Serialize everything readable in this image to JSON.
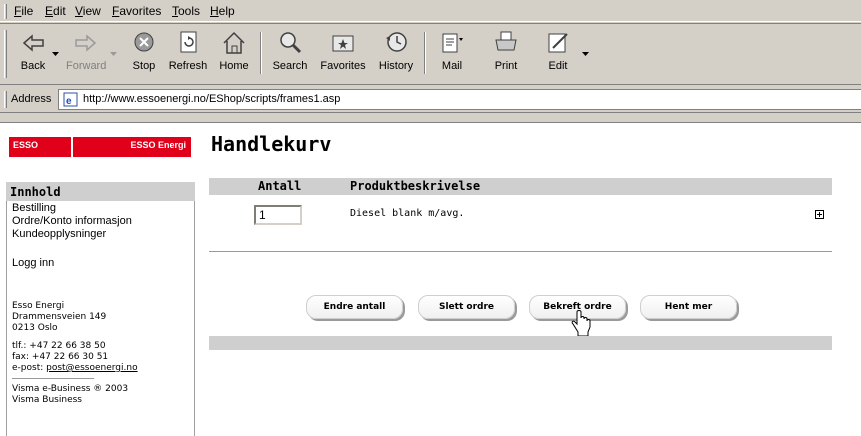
{
  "menu": [
    "File",
    "Edit",
    "View",
    "Favorites",
    "Tools",
    "Help"
  ],
  "toolbar": {
    "back": "Back",
    "forward": "Forward",
    "stop": "Stop",
    "refresh": "Refresh",
    "home": "Home",
    "search": "Search",
    "favorites": "Favorites",
    "history": "History",
    "mail": "Mail",
    "print": "Print",
    "edit": "Edit"
  },
  "address": {
    "label": "Address",
    "url": "http://www.essoenergi.no/EShop/scripts/frames1.asp"
  },
  "logo": {
    "left": "ESSO",
    "right": "ESSO Energi"
  },
  "sidebar": {
    "heading": "Innhold",
    "links": [
      "Bestilling",
      "Ordre/Konto informasjon",
      "Kundeopplysninger",
      "Logg inn"
    ],
    "company": [
      "Esso Energi",
      "Drammensveien 149",
      "0213 Oslo"
    ],
    "phone": "tlf.: +47 22 66 38 50",
    "fax": "fax: +47 22 66 30 51",
    "email_prefix": "e-post: ",
    "email": "post@essoenergi.no",
    "credits": [
      "Visma e-Business ® 2003",
      "Visma Business"
    ]
  },
  "main": {
    "title": "Handlekurv",
    "columns": {
      "quantity": "Antall",
      "description": "Produktbeskrivelse"
    },
    "rows": [
      {
        "quantity": "1",
        "description": "Diesel blank m/avg."
      }
    ],
    "buttons": {
      "change": "Endre antall",
      "delete": "Slett ordre",
      "confirm": "Bekreft ordre",
      "more": "Hent mer"
    }
  },
  "colors": {
    "brand_red": "#e0001a",
    "chrome": "#d4d0c8",
    "header_grey": "#cfcfcf"
  },
  "icons": [
    "back-icon",
    "forward-icon",
    "stop-icon",
    "refresh-icon",
    "home-icon",
    "search-icon",
    "favorites-icon",
    "history-icon",
    "mail-icon",
    "print-icon",
    "edit-icon",
    "ie-page-icon",
    "expand-icon",
    "hand-cursor-icon"
  ]
}
